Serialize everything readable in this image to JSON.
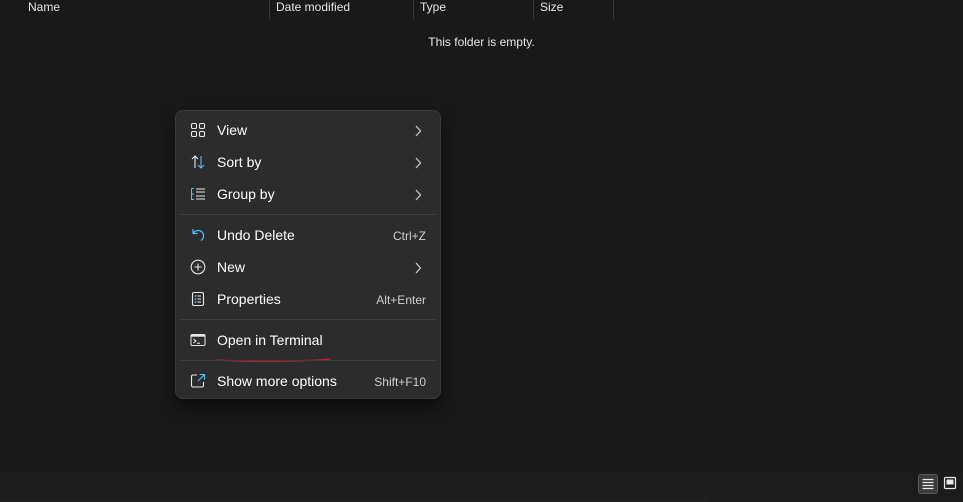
{
  "columns": {
    "name": "Name",
    "date_modified": "Date modified",
    "type": "Type",
    "size": "Size"
  },
  "empty_message": "This folder is empty.",
  "context_menu": {
    "items": [
      {
        "label": "View",
        "icon": "view-grid-icon",
        "submenu": true
      },
      {
        "label": "Sort by",
        "icon": "sort-icon",
        "submenu": true
      },
      {
        "label": "Group by",
        "icon": "group-list-icon",
        "submenu": true
      },
      {
        "label": "Undo Delete",
        "icon": "undo-icon",
        "shortcut": "Ctrl+Z"
      },
      {
        "label": "New",
        "icon": "new-plus-icon",
        "submenu": true
      },
      {
        "label": "Properties",
        "icon": "properties-icon",
        "shortcut": "Alt+Enter"
      },
      {
        "label": "Open in Terminal",
        "icon": "terminal-icon"
      },
      {
        "label": "Show more options",
        "icon": "open-external-icon",
        "shortcut": "Shift+F10"
      }
    ]
  },
  "status_bar": {
    "view_buttons": [
      {
        "icon": "details-view-icon",
        "active": true
      },
      {
        "icon": "tiles-view-icon",
        "active": false
      }
    ]
  },
  "colors": {
    "background": "#191919",
    "menu_background": "#2c2c2c",
    "accent_blue": "#4cc2ff",
    "annotation_red": "#b3202a"
  }
}
